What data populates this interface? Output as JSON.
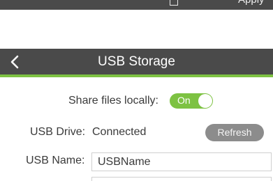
{
  "top_bar": {
    "cut_label": "Apply",
    "cut_icon": "save-icon"
  },
  "header": {
    "title": "USB Storage",
    "back_icon": "chevron-left-icon",
    "accent_color": "#7dc242",
    "bar_color": "#4a4a4a"
  },
  "share": {
    "label": "Share files locally:",
    "toggle_text": "On",
    "enabled": true
  },
  "drive": {
    "label": "USB Drive:",
    "status": "Connected",
    "refresh_label": "Refresh"
  },
  "name": {
    "label": "USB Name:",
    "value": "USBName"
  }
}
